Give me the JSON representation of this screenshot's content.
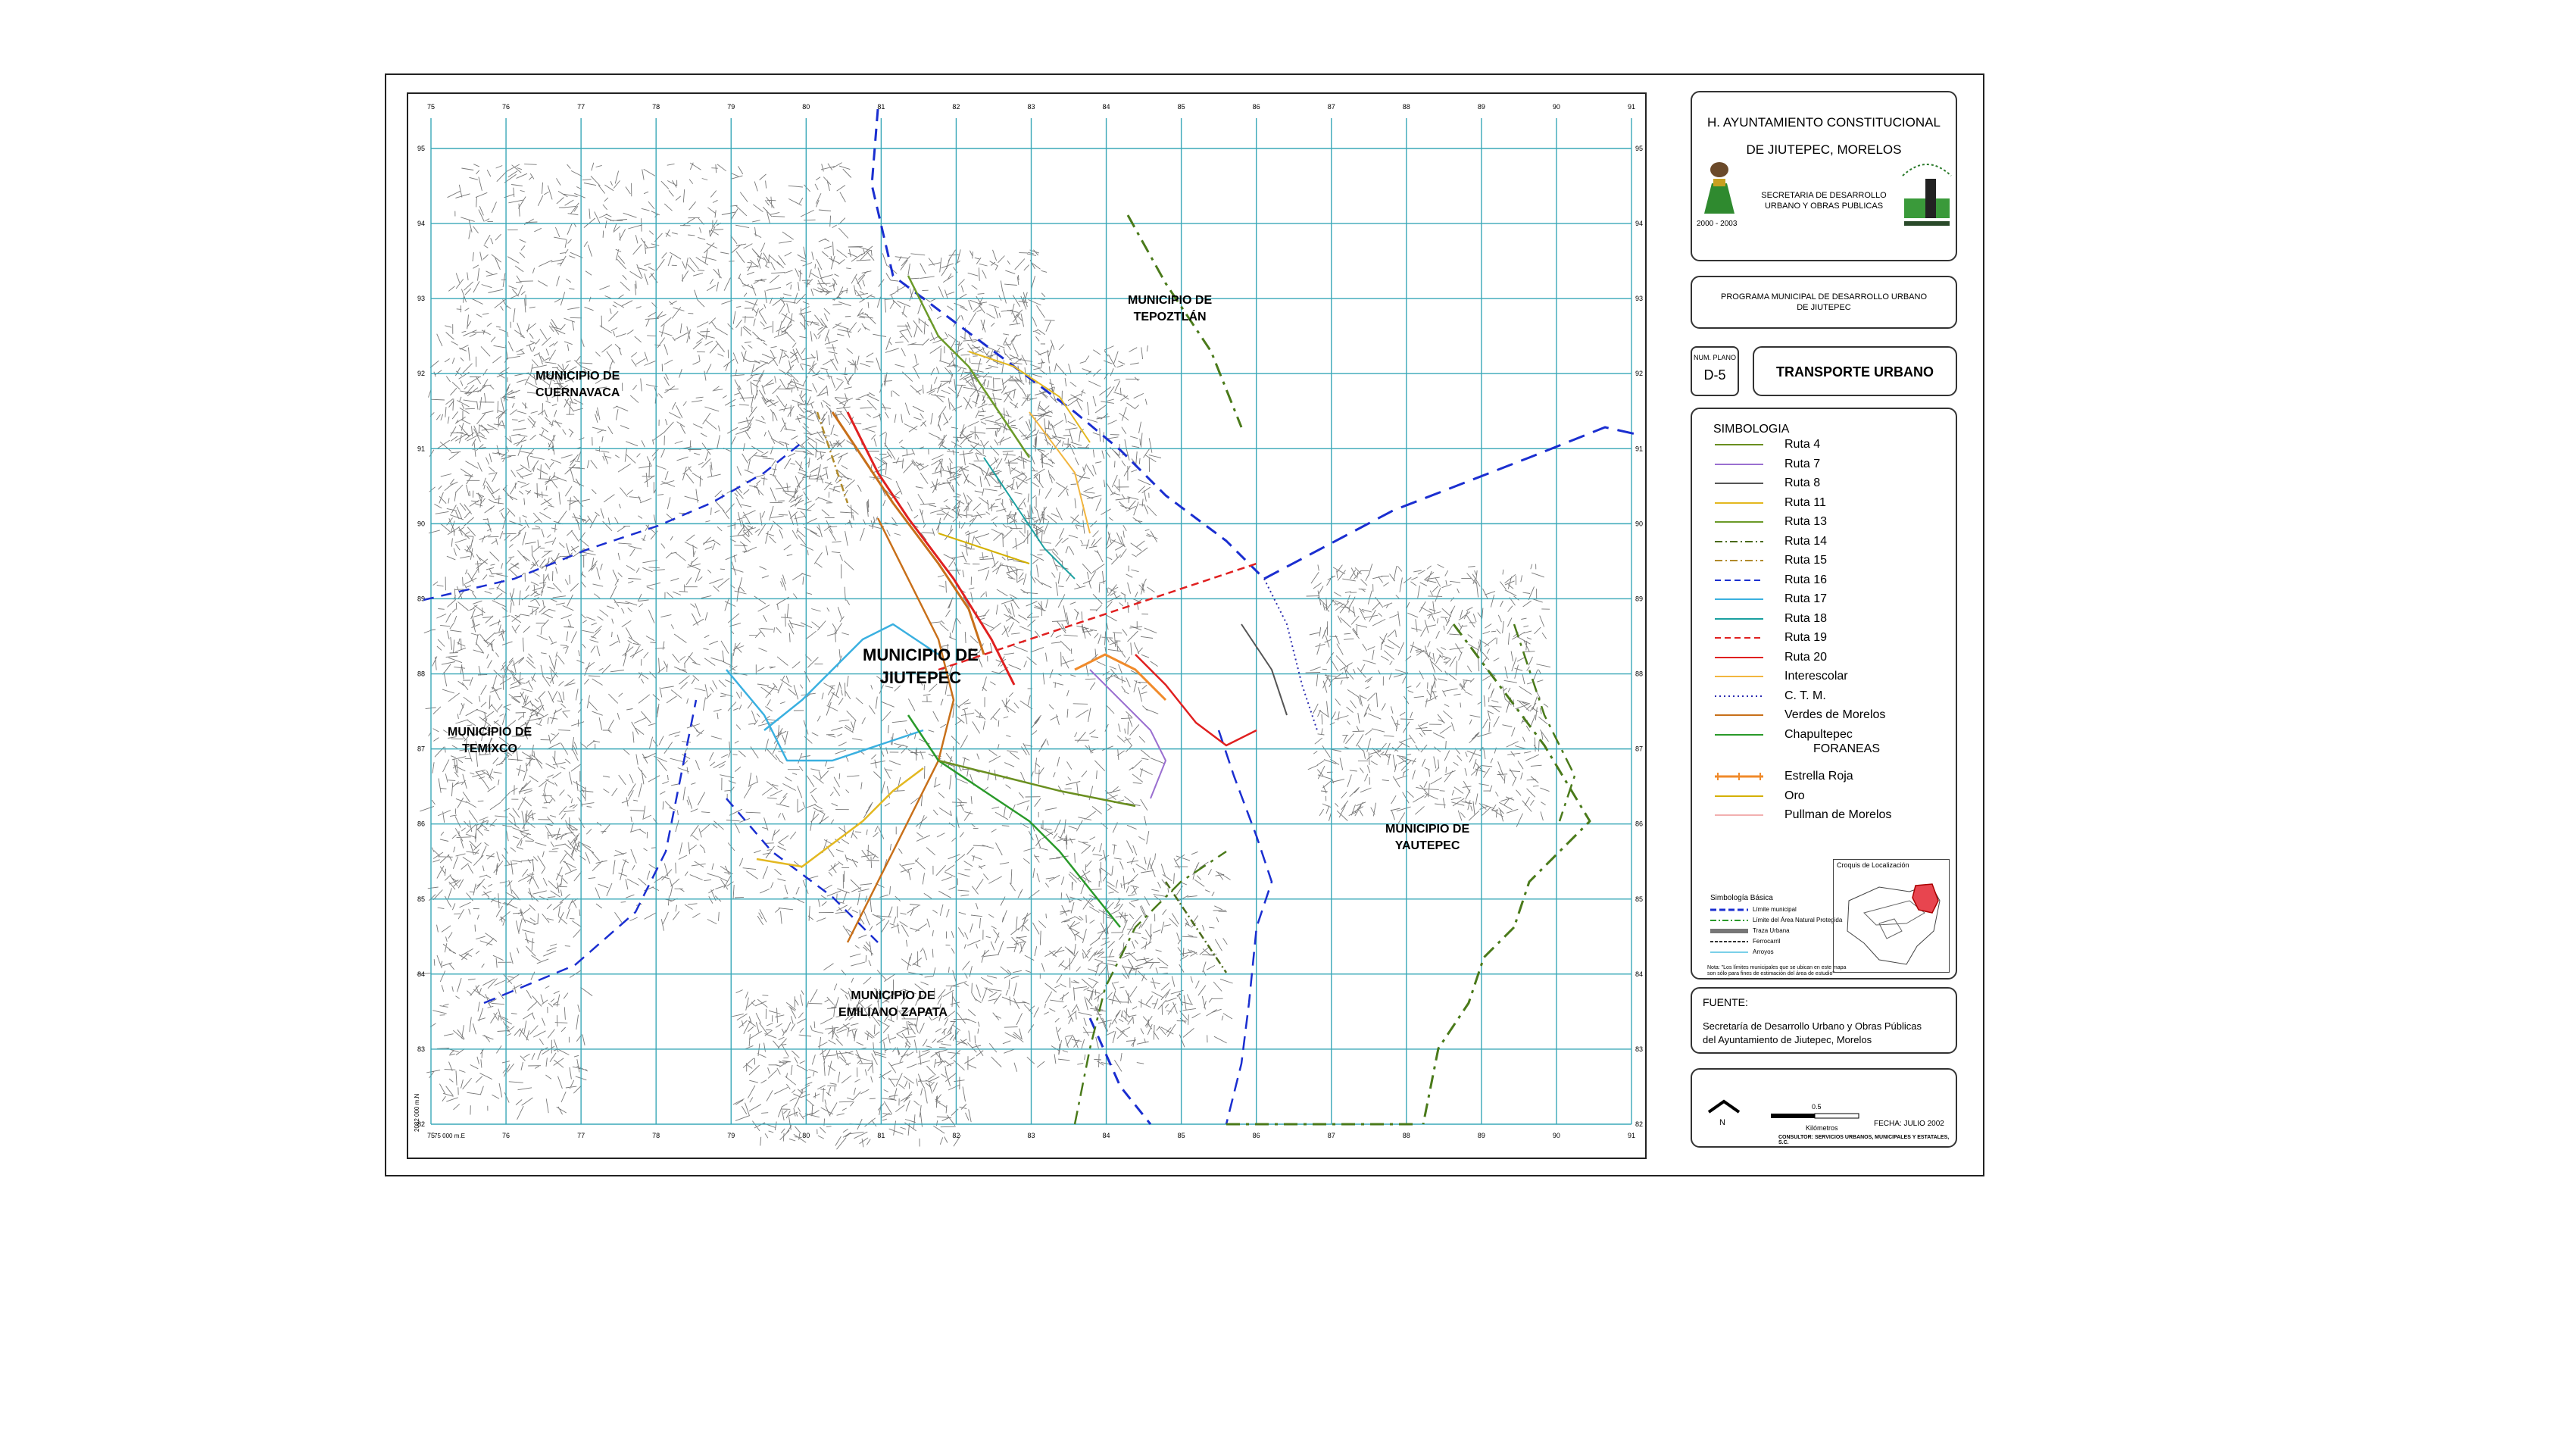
{
  "title_block": {
    "line1": "H. AYUNTAMIENTO CONSTITUCIONAL",
    "line2": "DE JIUTEPEC, MORELOS",
    "dept_line1": "SECRETARIA DE DESARROLLO",
    "dept_line2": "URBANO Y OBRAS PUBLICAS",
    "period": "2000 - 2003"
  },
  "program": {
    "line1": "PROGRAMA MUNICIPAL DE DESARROLLO URBANO",
    "line2": "DE JIUTEPEC"
  },
  "plan": {
    "num_label": "NUM. PLANO",
    "num": "D-5",
    "title": "TRANSPORTE URBANO"
  },
  "legend": {
    "title": "SIMBOLOGIA",
    "foraneas_title": "FORANEAS",
    "routes": [
      {
        "label": "Ruta 4",
        "color": "#6a8f1f",
        "style": "solid"
      },
      {
        "label": "Ruta 7",
        "color": "#9a6fd0",
        "style": "solid"
      },
      {
        "label": "Ruta 8",
        "color": "#555555",
        "style": "solid"
      },
      {
        "label": "Ruta 11",
        "color": "#e3b820",
        "style": "solid"
      },
      {
        "label": "Ruta 13",
        "color": "#6b9a28",
        "style": "solid"
      },
      {
        "label": "Ruta 14",
        "color": "#4a6a1a",
        "style": "dashdot"
      },
      {
        "label": "Ruta 15",
        "color": "#b08a2a",
        "style": "dashdot"
      },
      {
        "label": "Ruta 16",
        "color": "#1a2ed0",
        "style": "dashed"
      },
      {
        "label": "Ruta 17",
        "color": "#3ab0e0",
        "style": "solid"
      },
      {
        "label": "Ruta 18",
        "color": "#1aa0a0",
        "style": "solid"
      },
      {
        "label": "Ruta 19",
        "color": "#e02020",
        "style": "dashed"
      },
      {
        "label": "Ruta 20",
        "color": "#e02020",
        "style": "solid"
      },
      {
        "label": "Interescolar",
        "color": "#f2b640",
        "style": "solid"
      },
      {
        "label": "C. T. M.",
        "color": "#2a2ab0",
        "style": "dotted"
      },
      {
        "label": "Verdes de Morelos",
        "color": "#c8701a",
        "style": "solid"
      },
      {
        "label": "Chapultepec",
        "color": "#2a9a2a",
        "style": "solid"
      }
    ],
    "foraneas": [
      {
        "label": "Estrella Roja",
        "color": "#f08a2a",
        "style": "ticked"
      },
      {
        "label": "Oro",
        "color": "#d4b000",
        "style": "solid"
      },
      {
        "label": "Pullman de Morelos",
        "color": "#f2b0b0",
        "style": "solid"
      }
    ]
  },
  "basic_symbols": {
    "title": "Simbología Básica",
    "items": [
      "Límite municipal",
      "Límite del Área Natural Protegida",
      "Traza Urbana",
      "Ferrocarril",
      "Arroyos"
    ],
    "location_title": "Croquis de Localización",
    "note": "Nota: \"Los límites municipales que se ubican en este mapa son sólo para fines de estimación del área de estudio\""
  },
  "source": {
    "label": "FUENTE:",
    "line1": "Secretaría de Desarrollo Urbano y Obras Públicas",
    "line2": "del Ayuntamiento de Jiutepec, Morelos"
  },
  "footer": {
    "north": "N",
    "scale_value": "0.5",
    "scale_unit": "Kilómetros",
    "date": "FECHA: JULIO 2002",
    "consultant": "CONSULTOR: SERVICIOS URBANOS, MUNICIPALES Y ESTATALES, S.C."
  },
  "map": {
    "municipalities": [
      {
        "line1": "MUNICIPIO DE",
        "line2": "TEPOZTLÁN"
      },
      {
        "line1": "MUNICIPIO DE",
        "line2": "CUERNAVACA"
      },
      {
        "line1": "MUNICIPIO DE",
        "line2": "JIUTEPEC"
      },
      {
        "line1": "MUNICIPIO DE",
        "line2": "TEMIXCO"
      },
      {
        "line1": "MUNICIPIO DE",
        "line2": "YAUTEPEC"
      },
      {
        "line1": "MUNICIPIO DE",
        "line2": "EMILIANO ZAPATA"
      }
    ],
    "grid_top_labels": [
      "75",
      "76",
      "77",
      "78",
      "79",
      "80",
      "81",
      "82",
      "83",
      "84",
      "85",
      "86",
      "87",
      "88",
      "89",
      "90",
      "91"
    ],
    "grid_side_labels": [
      "95",
      "94",
      "93",
      "92",
      "91",
      "90",
      "89",
      "88",
      "87",
      "86",
      "85",
      "84",
      "83",
      "82"
    ],
    "corner_label": "75 000 m.E",
    "side_corner_label": "2082 000 m.N"
  },
  "colors": {
    "grid": "#3aa8b8",
    "frame": "#222222"
  }
}
